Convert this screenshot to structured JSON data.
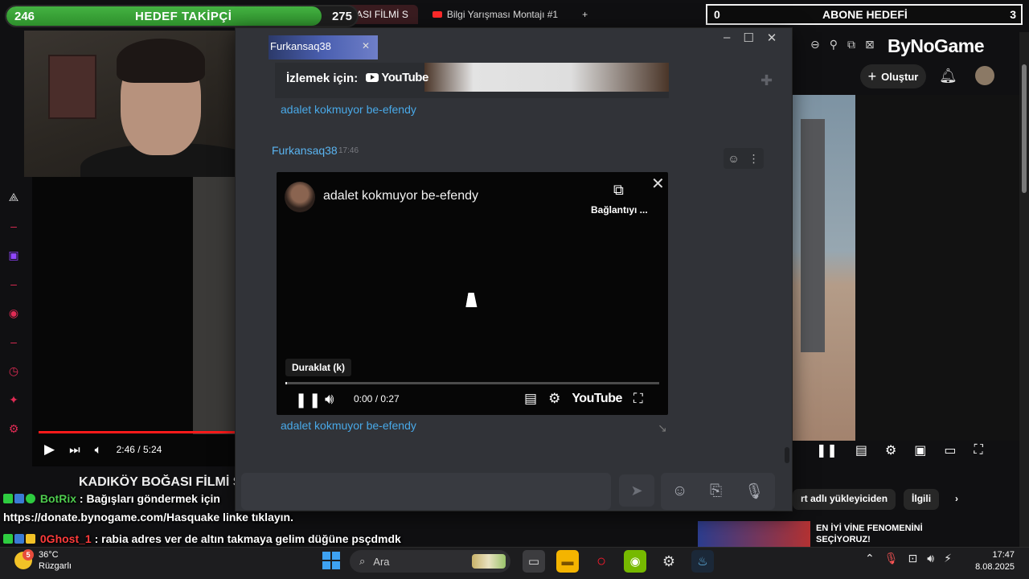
{
  "overlay": {
    "follower_goal": {
      "current": "246",
      "target": "275",
      "label": "HEDEF TAKİPÇİ",
      "progress": 0.9
    },
    "subscriber_goal": {
      "current": "0",
      "label": "ABONE HEDEFİ",
      "target": "3"
    }
  },
  "browser": {
    "tabs": [
      {
        "label": "KADIKÖY BOĞASI FİLMİ S"
      },
      {
        "label": "Bilgi Yarışması Montajı #1"
      }
    ],
    "new_tab": "+",
    "logo": "ByNoGame",
    "create_label": "Oluştur"
  },
  "left_video": {
    "time": "2:46 / 5:24",
    "title": "KADIKÖY BOĞASI FİLMİ S"
  },
  "right_video": {
    "chips": [
      "rt adlı yükleyiciden",
      "İlgili"
    ],
    "recommended_title": "EN İYİ VİNE FENOMENİNİ SEÇİYORUZ!"
  },
  "discord": {
    "window_title": "Furkansaq38",
    "embed_watch_label": "İzlemek için:",
    "youtube_label": "YouTube",
    "link_text": "adalet kokmuyor be-efendy",
    "author": "Furkansaq38",
    "timestamp": "17:46",
    "player": {
      "title": "adalet kokmuyor be-efendy",
      "copy_label": "Bağlantıyı ...",
      "tooltip": "Duraklat (k)",
      "time": "0:00 / 0:27",
      "progress": 0,
      "youtube_label": "YouTube"
    },
    "link_text_2": "adalet kokmuyor be-efendy"
  },
  "chat": [
    {
      "user": "BotRix",
      "color": "#4ecb4e",
      "text": "Bağışları göndermek için",
      "text2": "https://donate.bynogame.com/Hasquake linke tıklayın."
    },
    {
      "user": "0Ghost_1",
      "color": "#ff3b3b",
      "text": "rabia adres ver de altın takmaya gelim düğüne psçdmdk"
    }
  ],
  "taskbar": {
    "weather_temp": "36°C",
    "weather_desc": "Rüzgarlı",
    "weather_badge": "5",
    "search_label": "Ara",
    "time": "17:47",
    "date": "8.08.2025"
  },
  "colors": {
    "accent_green": "#44b342",
    "discord_link": "#49a9e8",
    "twitch_pink": "#e02b54"
  }
}
